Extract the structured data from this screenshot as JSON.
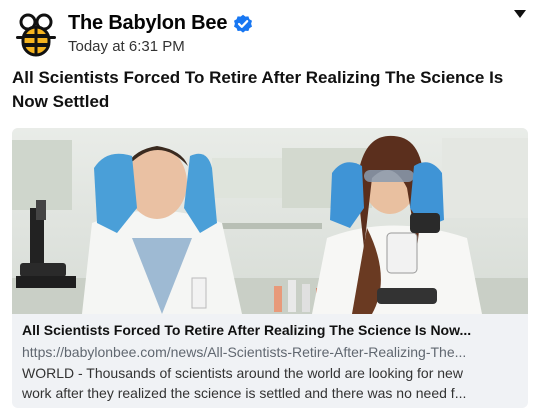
{
  "post": {
    "page_name": "The Babylon Bee",
    "timestamp": "Today at 6:31 PM",
    "text": "All Scientists Forced To Retire After Realizing The Science Is Now Settled",
    "icons": {
      "logo": "bee-logo-icon",
      "verified": "verified-badge-icon",
      "menu": "chevron-down-icon"
    },
    "colors": {
      "verified": "#1877f2",
      "card_bg": "#f0f2f5",
      "url": "#606770"
    }
  },
  "link_card": {
    "title": "All Scientists Forced To Retire After Realizing The Science Is Now...",
    "url": "https://babylonbee.com/news/All-Scientists-Retire-After-Realizing-The...",
    "description_line1": "WORLD - Thousands of scientists around the world are looking for new",
    "description_line2": "work after they realized the science is settled and there was no need f..."
  }
}
